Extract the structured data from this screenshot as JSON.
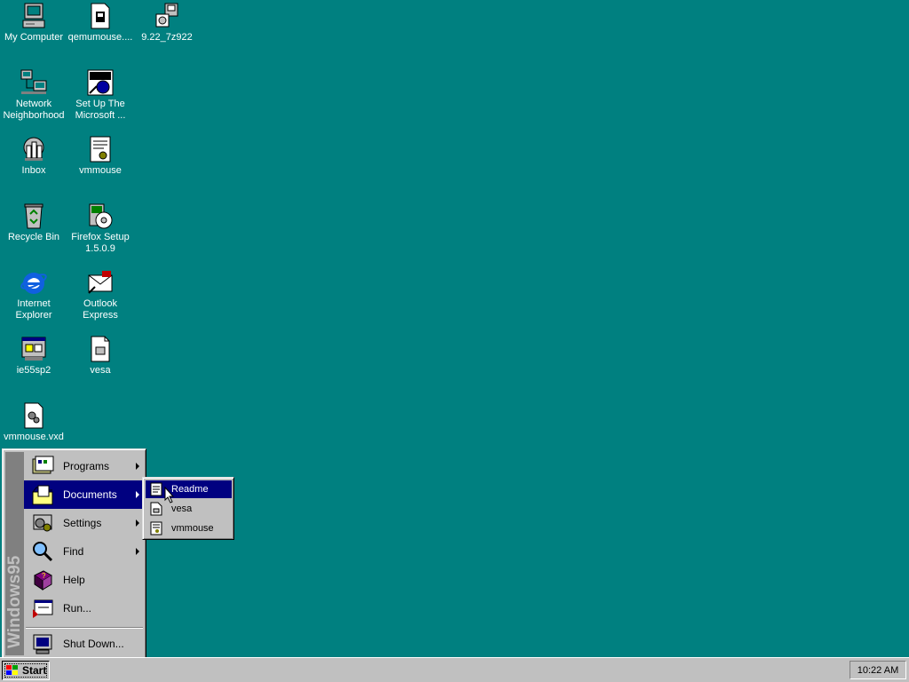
{
  "desktop": {
    "icons": [
      {
        "name": "my-computer-icon",
        "label": "My Computer"
      },
      {
        "name": "qemumouse-icon",
        "label": "qemumouse...."
      },
      {
        "name": "setup-922-icon",
        "label": "9.22_7z922"
      },
      {
        "name": "network-neighborhood-icon",
        "label": "Network\nNeighborhood"
      },
      {
        "name": "msn-setup-icon",
        "label": "Set Up The\nMicrosoft ..."
      },
      {
        "name": "inbox-icon",
        "label": "Inbox"
      },
      {
        "name": "vmmouse-icon",
        "label": "vmmouse"
      },
      {
        "name": "recycle-bin-icon",
        "label": "Recycle Bin"
      },
      {
        "name": "firefox-setup-icon",
        "label": "Firefox Setup\n1.5.0.9"
      },
      {
        "name": "internet-explorer-icon",
        "label": "Internet\nExplorer"
      },
      {
        "name": "outlook-express-icon",
        "label": "Outlook\nExpress"
      },
      {
        "name": "ie55sp2-icon",
        "label": "ie55sp2"
      },
      {
        "name": "vesa-icon",
        "label": "vesa"
      },
      {
        "name": "vmmouse-vxd-icon",
        "label": "vmmouse.vxd"
      }
    ]
  },
  "start_menu": {
    "banner": "Windows95",
    "items": [
      {
        "label": "Programs",
        "submenu": true
      },
      {
        "label": "Documents",
        "submenu": true
      },
      {
        "label": "Settings",
        "submenu": true
      },
      {
        "label": "Find",
        "submenu": true
      },
      {
        "label": "Help",
        "submenu": false
      },
      {
        "label": "Run...",
        "submenu": false
      },
      {
        "label": "Shut Down...",
        "submenu": false
      }
    ]
  },
  "documents_submenu": {
    "items": [
      {
        "label": "Readme"
      },
      {
        "label": "vesa"
      },
      {
        "label": "vmmouse"
      }
    ]
  },
  "taskbar": {
    "start_label": "Start",
    "clock": "10:22 AM"
  },
  "colors": {
    "desktop": "#008080",
    "highlight": "#000080",
    "face": "#c0c0c0"
  }
}
